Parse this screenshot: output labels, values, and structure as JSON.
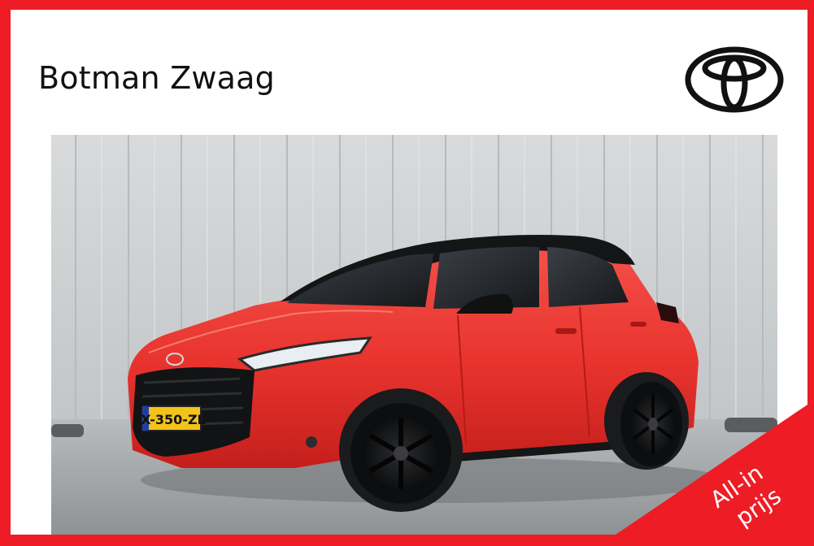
{
  "dealer": {
    "name": "Botman Zwaag"
  },
  "brand": {
    "logo_icon": "toyota-logo-icon"
  },
  "vehicle_photo": {
    "license_plate": "X-350-ZL",
    "car_color": "#ee2c2c"
  },
  "badge": {
    "line1": "All-in",
    "line2": "prijs",
    "color": "#ee1c25"
  },
  "colors": {
    "frame": "#ee1c25",
    "background": "#ffffff",
    "text": "#111111"
  }
}
